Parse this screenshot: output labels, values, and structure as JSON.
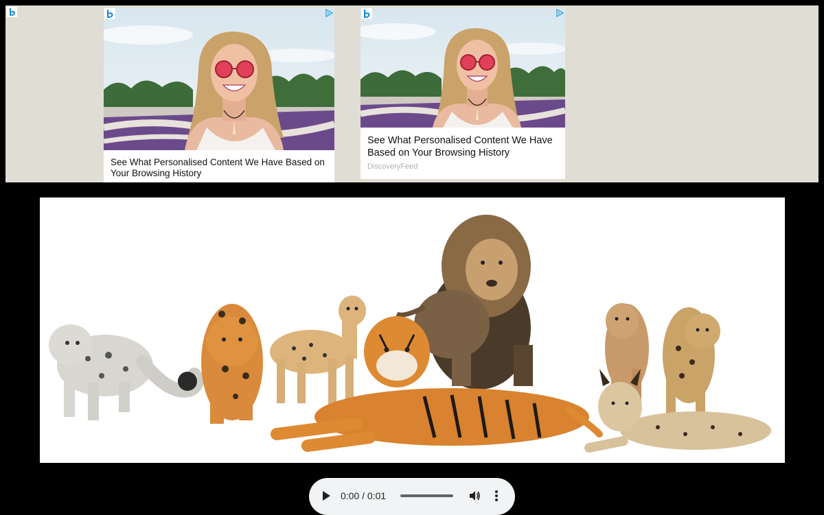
{
  "ad_banner": {
    "background": "#e0ddd4",
    "corner_logo": "bing-logo-icon",
    "cards": [
      {
        "logo": "bing-logo-icon",
        "adchoices": "adchoices-icon",
        "image": "smiling-woman-pink-sunglasses-photo",
        "headline": "See What Personalised Content We Have Based on Your Browsing History"
      },
      {
        "logo": "bing-logo-icon",
        "adchoices": "adchoices-icon",
        "image": "smiling-woman-pink-sunglasses-photo",
        "headline": "See What Personalised Content We Have Based on Your Browsing History",
        "source": "DiscoveryFeed"
      }
    ]
  },
  "main_image": {
    "subject": "big-cats-group-photo",
    "animals": [
      "snow leopard",
      "jaguar",
      "cheetah",
      "tiger",
      "lion",
      "puma",
      "leopard",
      "lynx"
    ]
  },
  "audio": {
    "time": "0:00 / 0:01",
    "progress": 0,
    "play_icon": "play-icon",
    "volume_icon": "volume-icon",
    "menu_icon": "more-vertical-icon"
  },
  "colors": {
    "page_background": "#000000",
    "player_background": "#f1f3f4",
    "bing_blue": "#1a8ad6"
  }
}
